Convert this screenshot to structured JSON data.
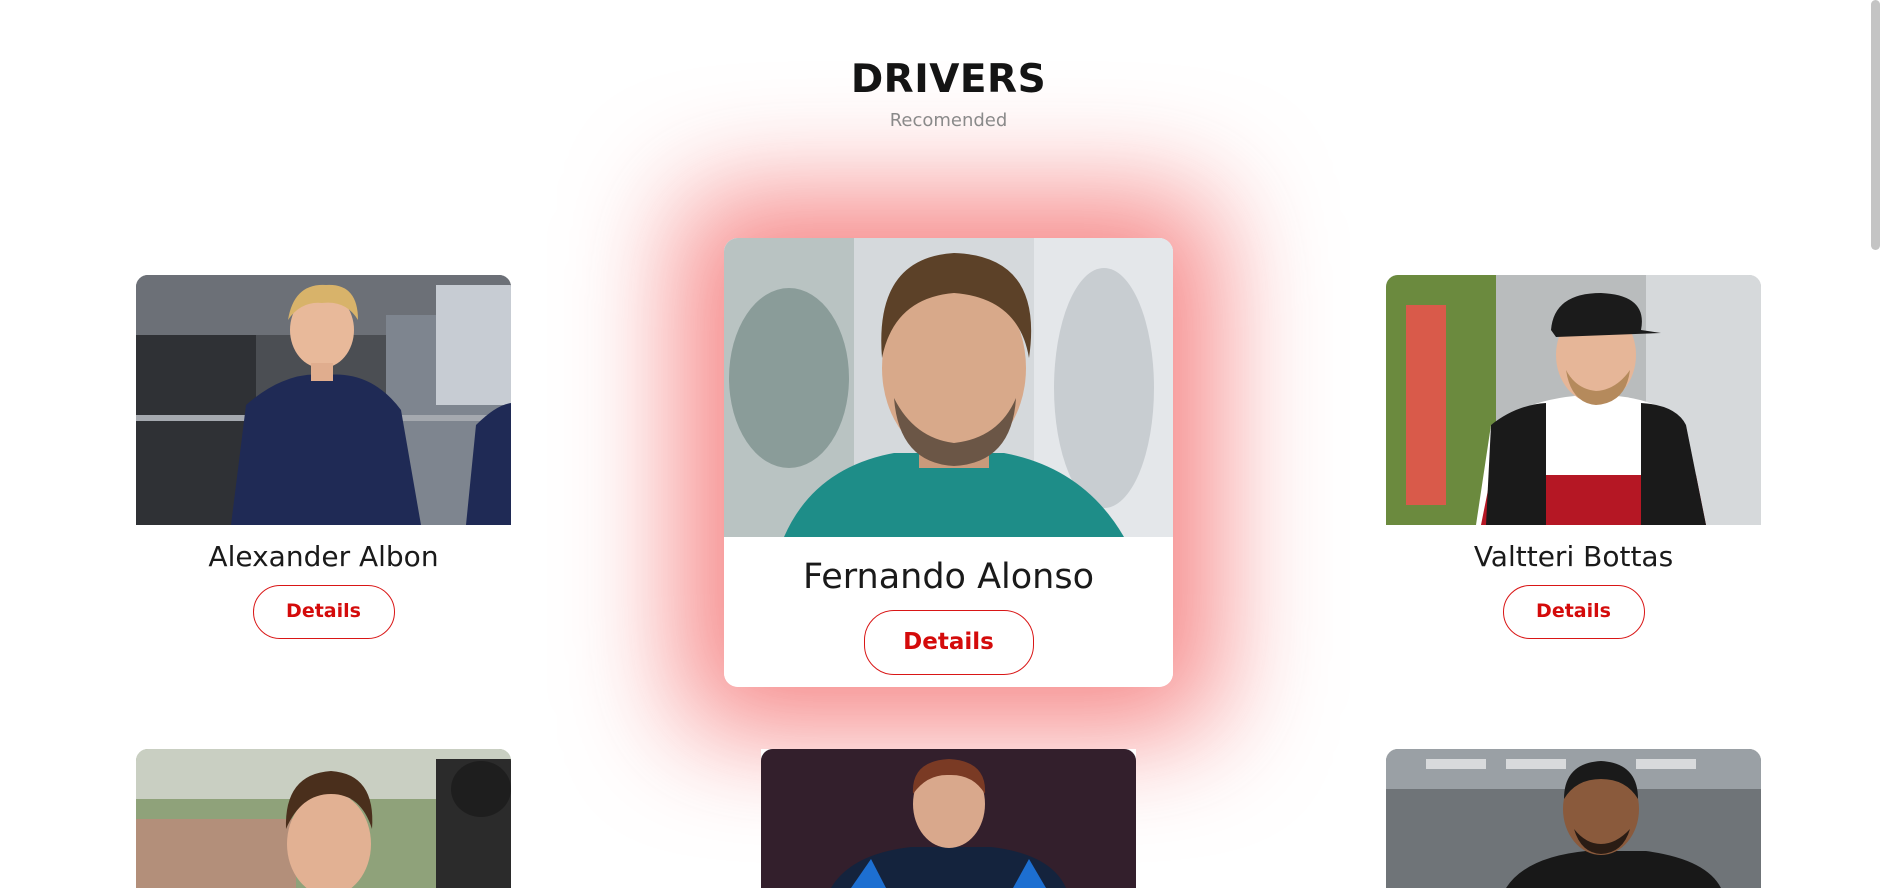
{
  "header": {
    "title": "DRIVERS",
    "subtitle": "Recomended"
  },
  "drivers": [
    {
      "name": "Alexander Albon",
      "button": "Details",
      "photo_icon": "driver-photo"
    },
    {
      "name": "Fernando Alonso",
      "button": "Details",
      "photo_icon": "driver-photo",
      "featured": true
    },
    {
      "name": "Valtteri Bottas",
      "button": "Details",
      "photo_icon": "driver-photo"
    },
    {
      "name": "",
      "button": "",
      "photo_icon": "driver-photo"
    },
    {
      "name": "",
      "button": "",
      "photo_icon": "driver-photo"
    },
    {
      "name": "",
      "button": "",
      "photo_icon": "driver-photo"
    }
  ],
  "colors": {
    "accent": "#d40b0b",
    "glow": "#ee2828",
    "title": "#141414",
    "subtitle": "#8a8a8a"
  }
}
